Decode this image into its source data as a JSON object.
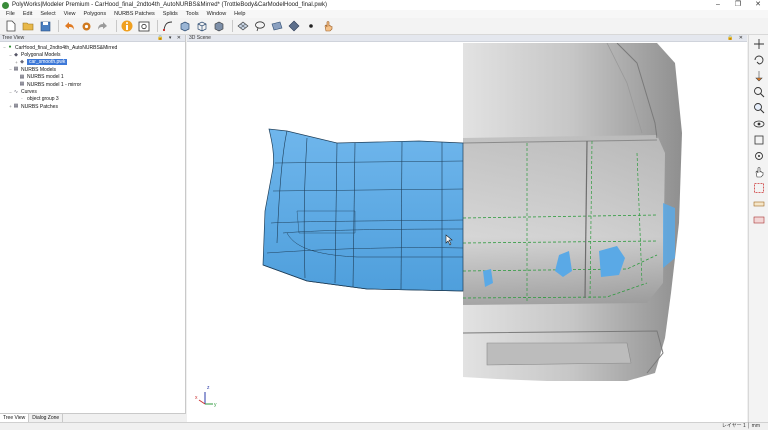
{
  "window": {
    "title": "PolyWorks|Modeler Premium - CarHood_final_2ndto4th_AutoNURBS&Mirred* (TrottleBody&CarModelHood_final.pwk)",
    "controls": [
      "–",
      "❐",
      "✕"
    ]
  },
  "menu": [
    "File",
    "Edit",
    "Select",
    "View",
    "Polygons",
    "NURBS Patches",
    "Splids",
    "Tools",
    "Window",
    "Help"
  ],
  "toolbar_icons": [
    "new-file-icon",
    "open-folder-icon",
    "save-icon",
    "undo-icon",
    "settings-gear-icon",
    "redo-icon",
    "info-orange-icon",
    "screenshot-icon",
    "curve-tool-icon",
    "cube-solid-icon",
    "cube-wire-icon",
    "box-tool-icon",
    "mesh-tool-icon",
    "lasso-icon",
    "plane-icon",
    "diamond-icon",
    "point-icon",
    "hand-cursor-icon"
  ],
  "tree_panel": {
    "title": "Tree View",
    "header_buttons": "🔒 ▾ ✕",
    "nodes": [
      {
        "label": "CarHood_final_2ndto4th_AutoNURBS&Mirred",
        "level": 0
      },
      {
        "label": "Polygonal Models",
        "level": 1
      },
      {
        "label": "car_smooth.pwk",
        "level": 2,
        "selected": true
      },
      {
        "label": "NURBS Models",
        "level": 1
      },
      {
        "label": "NURBS model 1",
        "level": 2
      },
      {
        "label": "NURBS model 1 - mirror",
        "level": 2
      },
      {
        "label": "Curves",
        "level": 1
      },
      {
        "label": "object group 3",
        "level": 2
      },
      {
        "label": "NURBS Patches",
        "level": 1
      }
    ]
  },
  "bottom_tabs": [
    "Tree View",
    "Dialog Zone"
  ],
  "scene_panel": {
    "title": "3D Scene",
    "header_buttons": "🔒 ✕"
  },
  "axis_labels": {
    "x": "x",
    "y": "y",
    "z": "z"
  },
  "right_toolbar_icons": [
    "move-icon",
    "rotate-icon",
    "align-icon",
    "zoom-icon",
    "zoom-fit-icon",
    "eye-icon",
    "view-cube-icon",
    "settings-icon",
    "hand-icon",
    "select-icon",
    "measure-icon",
    "clip-icon"
  ],
  "status": {
    "text": "レイヤー 1 │ mm"
  },
  "colors": {
    "nurbs_surface": "#5aa9e6",
    "mesh_gray": "#c8c8c8",
    "accent": "#3c78d8"
  }
}
